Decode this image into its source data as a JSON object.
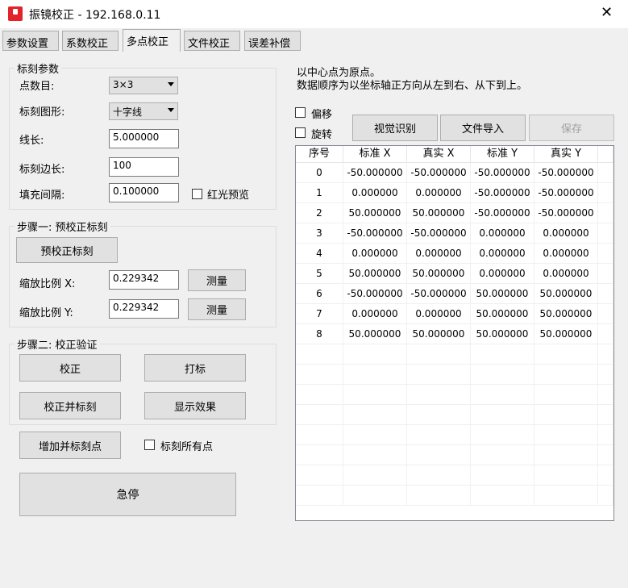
{
  "window": {
    "title": "振镜校正 - 192.168.0.11",
    "close": "✕"
  },
  "tabs": [
    "参数设置",
    "系数校正",
    "多点校正",
    "文件校正",
    "误差补偿"
  ],
  "group1": {
    "label": "标刻参数",
    "points_label": "点数目:",
    "points_value": "3×3",
    "pattern_label": "标刻图形:",
    "pattern_value": "十字线",
    "length_label": "线长:",
    "length_value": "5.000000",
    "side_label": "标刻边长:",
    "side_value": "100",
    "fill_label": "填充间隔:",
    "fill_value": "0.100000",
    "redlight_label": "红光预览"
  },
  "group2": {
    "label": "步骤一: 预校正标刻",
    "premark_button": "预校正标刻",
    "scale_x_label": "缩放比例 X:",
    "scale_x_value": "0.229342",
    "scale_y_label": "缩放比例 Y:",
    "scale_y_value": "0.229342",
    "measure_button": "测量"
  },
  "group3": {
    "label": "步骤二: 校正验证",
    "correct_button": "校正",
    "mark_button": "打标",
    "correct_mark_button": "校正并标刻",
    "show_button": "显示效果"
  },
  "add_mark_button": "增加并标刻点",
  "mark_all_label": "标刻所有点",
  "estop_button": "急停",
  "info": {
    "line1": "以中心点为原点。",
    "line2": "数据顺序为以坐标轴正方向从左到右、从下到上。"
  },
  "offset_label": "偏移",
  "rotate_label": "旋转",
  "vision_button": "视觉识别",
  "import_button": "文件导入",
  "save_button": "保存",
  "table": {
    "headers": [
      "序号",
      "标准 X",
      "真实 X",
      "标准 Y",
      "真实 Y"
    ],
    "rows": [
      [
        "0",
        "-50.000000",
        "-50.000000",
        "-50.000000",
        "-50.000000"
      ],
      [
        "1",
        "0.000000",
        "0.000000",
        "-50.000000",
        "-50.000000"
      ],
      [
        "2",
        "50.000000",
        "50.000000",
        "-50.000000",
        "-50.000000"
      ],
      [
        "3",
        "-50.000000",
        "-50.000000",
        "0.000000",
        "0.000000"
      ],
      [
        "4",
        "0.000000",
        "0.000000",
        "0.000000",
        "0.000000"
      ],
      [
        "5",
        "50.000000",
        "50.000000",
        "0.000000",
        "0.000000"
      ],
      [
        "6",
        "-50.000000",
        "-50.000000",
        "50.000000",
        "50.000000"
      ],
      [
        "7",
        "0.000000",
        "0.000000",
        "50.000000",
        "50.000000"
      ],
      [
        "8",
        "50.000000",
        "50.000000",
        "50.000000",
        "50.000000"
      ]
    ]
  }
}
